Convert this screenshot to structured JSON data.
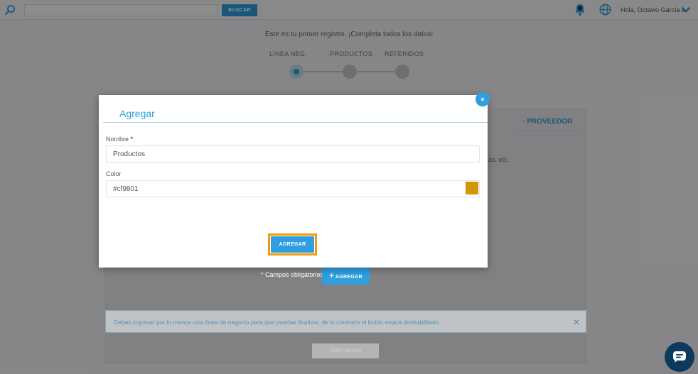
{
  "topbar": {
    "search": {
      "value": "",
      "placeholder": "",
      "button_label": "BUSCAR"
    },
    "notification_icon": "bell-icon",
    "language_icon": "globe-icon",
    "greeting": "Hola, Octavio García L"
  },
  "wizard": {
    "intro": "Este es tu primer registro. ¡Completa todos los datos!",
    "steps": [
      {
        "label": "LÍNEA NEG.",
        "active": true
      },
      {
        "label": "PRODUCTOS",
        "active": false
      },
      {
        "label": "REFERIDOS",
        "active": false
      }
    ]
  },
  "background": {
    "tab_label": "PROVEEDOR",
    "text_fragment": "as, etc.",
    "required_note": "* Campos obligatorios",
    "add_button": "AGREGAR",
    "add_button_icon": "plus-icon",
    "alert_text": "Debes ingresar por lo menos una línea de negocio para que puedas finalizar, de lo contrario el botón estará deshabilitado.",
    "continue_button": "CONTINUAR"
  },
  "modal": {
    "title": "Agregar",
    "close_label": "×",
    "fields": {
      "name": {
        "label": "Nombre",
        "required_mark": "*",
        "value": "Productos"
      },
      "color": {
        "label": "Color",
        "value": "#cf9801"
      }
    },
    "submit_label": "AGREGAR"
  },
  "colors": {
    "accent": "#2f9fde",
    "selected_color": "#cf9801",
    "focus_ring": "#f29a0b",
    "chat_button": "#0d3a5c"
  },
  "chat": {
    "icon": "chat-bubble-icon"
  }
}
